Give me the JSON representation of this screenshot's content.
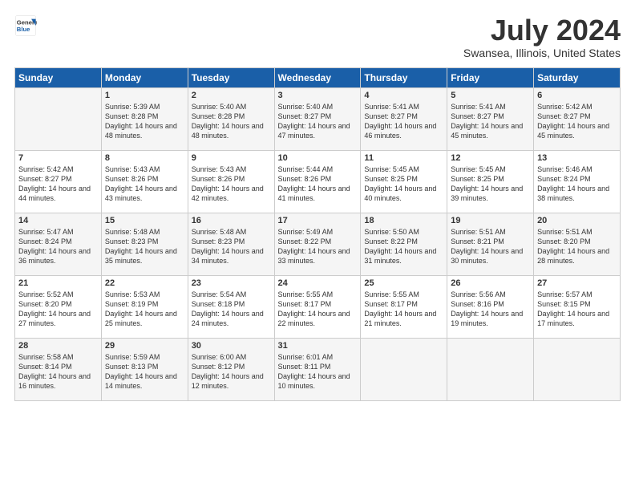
{
  "logo": {
    "general": "General",
    "blue": "Blue"
  },
  "title": "July 2024",
  "location": "Swansea, Illinois, United States",
  "days_of_week": [
    "Sunday",
    "Monday",
    "Tuesday",
    "Wednesday",
    "Thursday",
    "Friday",
    "Saturday"
  ],
  "weeks": [
    [
      {
        "day": "",
        "sunrise": "",
        "sunset": "",
        "daylight": ""
      },
      {
        "day": "1",
        "sunrise": "Sunrise: 5:39 AM",
        "sunset": "Sunset: 8:28 PM",
        "daylight": "Daylight: 14 hours and 48 minutes."
      },
      {
        "day": "2",
        "sunrise": "Sunrise: 5:40 AM",
        "sunset": "Sunset: 8:28 PM",
        "daylight": "Daylight: 14 hours and 48 minutes."
      },
      {
        "day": "3",
        "sunrise": "Sunrise: 5:40 AM",
        "sunset": "Sunset: 8:27 PM",
        "daylight": "Daylight: 14 hours and 47 minutes."
      },
      {
        "day": "4",
        "sunrise": "Sunrise: 5:41 AM",
        "sunset": "Sunset: 8:27 PM",
        "daylight": "Daylight: 14 hours and 46 minutes."
      },
      {
        "day": "5",
        "sunrise": "Sunrise: 5:41 AM",
        "sunset": "Sunset: 8:27 PM",
        "daylight": "Daylight: 14 hours and 45 minutes."
      },
      {
        "day": "6",
        "sunrise": "Sunrise: 5:42 AM",
        "sunset": "Sunset: 8:27 PM",
        "daylight": "Daylight: 14 hours and 45 minutes."
      }
    ],
    [
      {
        "day": "7",
        "sunrise": "Sunrise: 5:42 AM",
        "sunset": "Sunset: 8:27 PM",
        "daylight": "Daylight: 14 hours and 44 minutes."
      },
      {
        "day": "8",
        "sunrise": "Sunrise: 5:43 AM",
        "sunset": "Sunset: 8:26 PM",
        "daylight": "Daylight: 14 hours and 43 minutes."
      },
      {
        "day": "9",
        "sunrise": "Sunrise: 5:43 AM",
        "sunset": "Sunset: 8:26 PM",
        "daylight": "Daylight: 14 hours and 42 minutes."
      },
      {
        "day": "10",
        "sunrise": "Sunrise: 5:44 AM",
        "sunset": "Sunset: 8:26 PM",
        "daylight": "Daylight: 14 hours and 41 minutes."
      },
      {
        "day": "11",
        "sunrise": "Sunrise: 5:45 AM",
        "sunset": "Sunset: 8:25 PM",
        "daylight": "Daylight: 14 hours and 40 minutes."
      },
      {
        "day": "12",
        "sunrise": "Sunrise: 5:45 AM",
        "sunset": "Sunset: 8:25 PM",
        "daylight": "Daylight: 14 hours and 39 minutes."
      },
      {
        "day": "13",
        "sunrise": "Sunrise: 5:46 AM",
        "sunset": "Sunset: 8:24 PM",
        "daylight": "Daylight: 14 hours and 38 minutes."
      }
    ],
    [
      {
        "day": "14",
        "sunrise": "Sunrise: 5:47 AM",
        "sunset": "Sunset: 8:24 PM",
        "daylight": "Daylight: 14 hours and 36 minutes."
      },
      {
        "day": "15",
        "sunrise": "Sunrise: 5:48 AM",
        "sunset": "Sunset: 8:23 PM",
        "daylight": "Daylight: 14 hours and 35 minutes."
      },
      {
        "day": "16",
        "sunrise": "Sunrise: 5:48 AM",
        "sunset": "Sunset: 8:23 PM",
        "daylight": "Daylight: 14 hours and 34 minutes."
      },
      {
        "day": "17",
        "sunrise": "Sunrise: 5:49 AM",
        "sunset": "Sunset: 8:22 PM",
        "daylight": "Daylight: 14 hours and 33 minutes."
      },
      {
        "day": "18",
        "sunrise": "Sunrise: 5:50 AM",
        "sunset": "Sunset: 8:22 PM",
        "daylight": "Daylight: 14 hours and 31 minutes."
      },
      {
        "day": "19",
        "sunrise": "Sunrise: 5:51 AM",
        "sunset": "Sunset: 8:21 PM",
        "daylight": "Daylight: 14 hours and 30 minutes."
      },
      {
        "day": "20",
        "sunrise": "Sunrise: 5:51 AM",
        "sunset": "Sunset: 8:20 PM",
        "daylight": "Daylight: 14 hours and 28 minutes."
      }
    ],
    [
      {
        "day": "21",
        "sunrise": "Sunrise: 5:52 AM",
        "sunset": "Sunset: 8:20 PM",
        "daylight": "Daylight: 14 hours and 27 minutes."
      },
      {
        "day": "22",
        "sunrise": "Sunrise: 5:53 AM",
        "sunset": "Sunset: 8:19 PM",
        "daylight": "Daylight: 14 hours and 25 minutes."
      },
      {
        "day": "23",
        "sunrise": "Sunrise: 5:54 AM",
        "sunset": "Sunset: 8:18 PM",
        "daylight": "Daylight: 14 hours and 24 minutes."
      },
      {
        "day": "24",
        "sunrise": "Sunrise: 5:55 AM",
        "sunset": "Sunset: 8:17 PM",
        "daylight": "Daylight: 14 hours and 22 minutes."
      },
      {
        "day": "25",
        "sunrise": "Sunrise: 5:55 AM",
        "sunset": "Sunset: 8:17 PM",
        "daylight": "Daylight: 14 hours and 21 minutes."
      },
      {
        "day": "26",
        "sunrise": "Sunrise: 5:56 AM",
        "sunset": "Sunset: 8:16 PM",
        "daylight": "Daylight: 14 hours and 19 minutes."
      },
      {
        "day": "27",
        "sunrise": "Sunrise: 5:57 AM",
        "sunset": "Sunset: 8:15 PM",
        "daylight": "Daylight: 14 hours and 17 minutes."
      }
    ],
    [
      {
        "day": "28",
        "sunrise": "Sunrise: 5:58 AM",
        "sunset": "Sunset: 8:14 PM",
        "daylight": "Daylight: 14 hours and 16 minutes."
      },
      {
        "day": "29",
        "sunrise": "Sunrise: 5:59 AM",
        "sunset": "Sunset: 8:13 PM",
        "daylight": "Daylight: 14 hours and 14 minutes."
      },
      {
        "day": "30",
        "sunrise": "Sunrise: 6:00 AM",
        "sunset": "Sunset: 8:12 PM",
        "daylight": "Daylight: 14 hours and 12 minutes."
      },
      {
        "day": "31",
        "sunrise": "Sunrise: 6:01 AM",
        "sunset": "Sunset: 8:11 PM",
        "daylight": "Daylight: 14 hours and 10 minutes."
      },
      {
        "day": "",
        "sunrise": "",
        "sunset": "",
        "daylight": ""
      },
      {
        "day": "",
        "sunrise": "",
        "sunset": "",
        "daylight": ""
      },
      {
        "day": "",
        "sunrise": "",
        "sunset": "",
        "daylight": ""
      }
    ]
  ]
}
